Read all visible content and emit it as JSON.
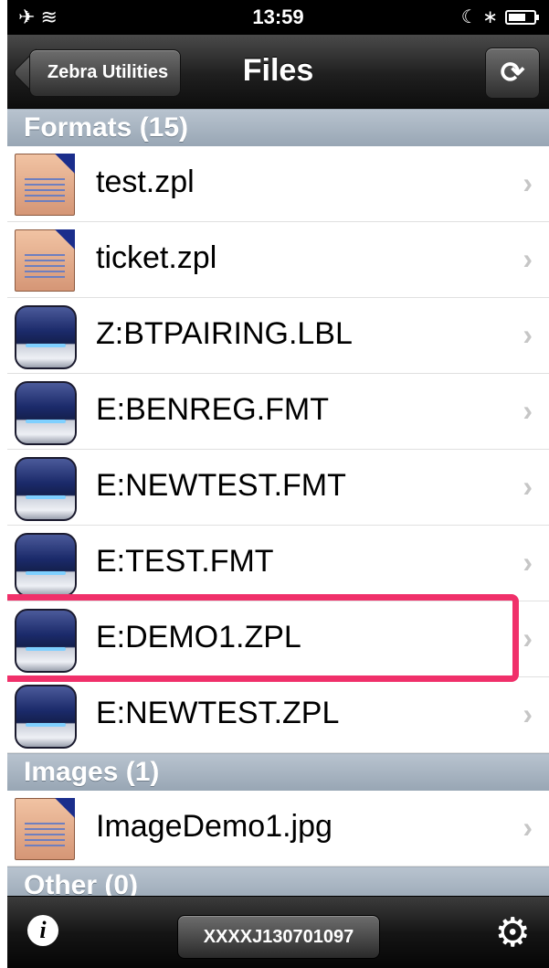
{
  "status_bar": {
    "left_icons": "✈ ≋",
    "time": "13:59",
    "right_icons": "☾ ∗"
  },
  "nav": {
    "back_label": "Zebra Utilities",
    "title": "Files",
    "refresh_icon": "⟳"
  },
  "sections": [
    {
      "title": "Formats  (15)",
      "items": [
        {
          "name": "test.zpl",
          "icon": "document-icon"
        },
        {
          "name": "ticket.zpl",
          "icon": "document-icon"
        },
        {
          "name": "Z:BTPAIRING.LBL",
          "icon": "printer-icon"
        },
        {
          "name": "E:BENREG.FMT",
          "icon": "printer-icon"
        },
        {
          "name": "E:NEWTEST.FMT",
          "icon": "printer-icon"
        },
        {
          "name": "E:TEST.FMT",
          "icon": "printer-icon"
        },
        {
          "name": "E:DEMO1.ZPL",
          "icon": "printer-icon"
        },
        {
          "name": "E:NEWTEST.ZPL",
          "icon": "printer-icon"
        }
      ]
    },
    {
      "title": "Images  (1)",
      "items": [
        {
          "name": "ImageDemo1.jpg",
          "icon": "document-icon"
        }
      ]
    },
    {
      "title": "Other  (0)",
      "items": []
    }
  ],
  "chevron": "›",
  "toolbar": {
    "info_label": "i",
    "serial_label": "XXXXJ130701097",
    "gear_icon": "⚙"
  },
  "colors": {
    "highlight": "#f0306a",
    "section_header": "#a8b4c1"
  }
}
